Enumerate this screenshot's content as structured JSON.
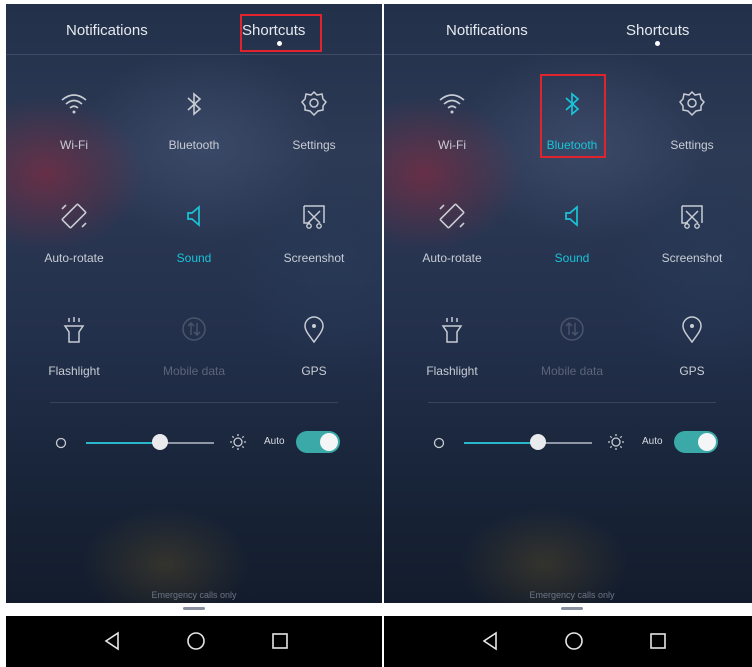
{
  "panels": [
    {
      "tabs": {
        "notifications": "Notifications",
        "shortcuts": "Shortcuts"
      },
      "tiles": [
        {
          "label": "Wi-Fi",
          "icon": "wifi-icon",
          "state": "normal"
        },
        {
          "label": "Bluetooth",
          "icon": "bluetooth-icon",
          "state": "normal"
        },
        {
          "label": "Settings",
          "icon": "gear-icon",
          "state": "normal"
        },
        {
          "label": "Auto-rotate",
          "icon": "auto-rotate-icon",
          "state": "normal"
        },
        {
          "label": "Sound",
          "icon": "speaker-icon",
          "state": "active"
        },
        {
          "label": "Screenshot",
          "icon": "screenshot-icon",
          "state": "normal"
        },
        {
          "label": "Flashlight",
          "icon": "flashlight-icon",
          "state": "normal"
        },
        {
          "label": "Mobile data",
          "icon": "mobile-data-icon",
          "state": "disabled"
        },
        {
          "label": "GPS",
          "icon": "location-pin-icon",
          "state": "normal"
        }
      ],
      "brightness": {
        "auto_label": "Auto",
        "auto_on": true,
        "level": 0.58
      },
      "emergency": "Emergency calls only",
      "highlight": "shortcuts-tab"
    },
    {
      "tabs": {
        "notifications": "Notifications",
        "shortcuts": "Shortcuts"
      },
      "tiles": [
        {
          "label": "Wi-Fi",
          "icon": "wifi-icon",
          "state": "normal"
        },
        {
          "label": "Bluetooth",
          "icon": "bluetooth-icon",
          "state": "active"
        },
        {
          "label": "Settings",
          "icon": "gear-icon",
          "state": "normal"
        },
        {
          "label": "Auto-rotate",
          "icon": "auto-rotate-icon",
          "state": "normal"
        },
        {
          "label": "Sound",
          "icon": "speaker-icon",
          "state": "active"
        },
        {
          "label": "Screenshot",
          "icon": "screenshot-icon",
          "state": "normal"
        },
        {
          "label": "Flashlight",
          "icon": "flashlight-icon",
          "state": "normal"
        },
        {
          "label": "Mobile data",
          "icon": "mobile-data-icon",
          "state": "disabled"
        },
        {
          "label": "GPS",
          "icon": "location-pin-icon",
          "state": "normal"
        }
      ],
      "brightness": {
        "auto_label": "Auto",
        "auto_on": true,
        "level": 0.58
      },
      "emergency": "Emergency calls only",
      "highlight": "bluetooth-tile"
    }
  ],
  "colors": {
    "accent": "#19c4d8",
    "highlight": "#e0232d",
    "toggle": "#3aa9a8"
  },
  "nav_icons": [
    "back-icon",
    "home-icon",
    "recents-icon"
  ]
}
